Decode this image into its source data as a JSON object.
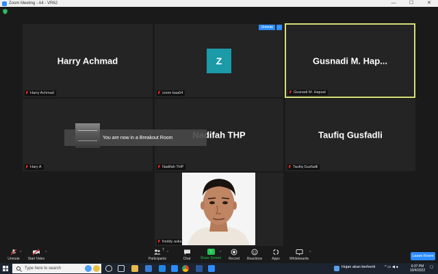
{
  "window": {
    "title": "Zoom Meeting - A4 - VR62",
    "minimize": "—",
    "maximize": "☐",
    "close": "✕"
  },
  "colors": {
    "accent": "#2d8cff",
    "active_speaker_border": "#d8e07a",
    "muted_red": "#e02828",
    "share_green": "#23c552",
    "avatar_teal": "#1b9aa8"
  },
  "tiles": [
    {
      "name": "Harry Achmad",
      "label": "Harry Achmad",
      "muted": true
    },
    {
      "name": "Z",
      "label": "zoom baa04",
      "muted": true,
      "avatar": true,
      "unmute_chip": "Unmute",
      "more_chip": "..."
    },
    {
      "name": "Gusnadi M. Hap...",
      "label": "Gusnadi M. Hapsal",
      "muted": true,
      "active": true
    },
    {
      "name": "",
      "label": "Hary A",
      "muted": true
    },
    {
      "name": "Nadifah THP",
      "label": "Nadifah THP",
      "muted": true
    },
    {
      "name": "Taufiq Gusfadli",
      "label": "Taufiq Gusfadli",
      "muted": true
    },
    {
      "name": "",
      "label": "freddy aulia",
      "muted": true,
      "photo": true
    }
  ],
  "toast": {
    "message": "You are now in a Breakout Room"
  },
  "toolbar": {
    "unmute": "Unmute",
    "start_video": "Start Video",
    "participants": "Participants",
    "participants_count": "7",
    "chat": "Chat",
    "share_screen": "Share Screen",
    "record": "Record",
    "reactions": "Reactions",
    "apps": "Apps",
    "whiteboards": "Whiteboards",
    "leave_room": "Leave Room"
  },
  "taskbar": {
    "search_placeholder": "Type here to search",
    "weather": "Hujan akan berhenti",
    "time": "6:37 PM",
    "date": "10/4/2022"
  }
}
